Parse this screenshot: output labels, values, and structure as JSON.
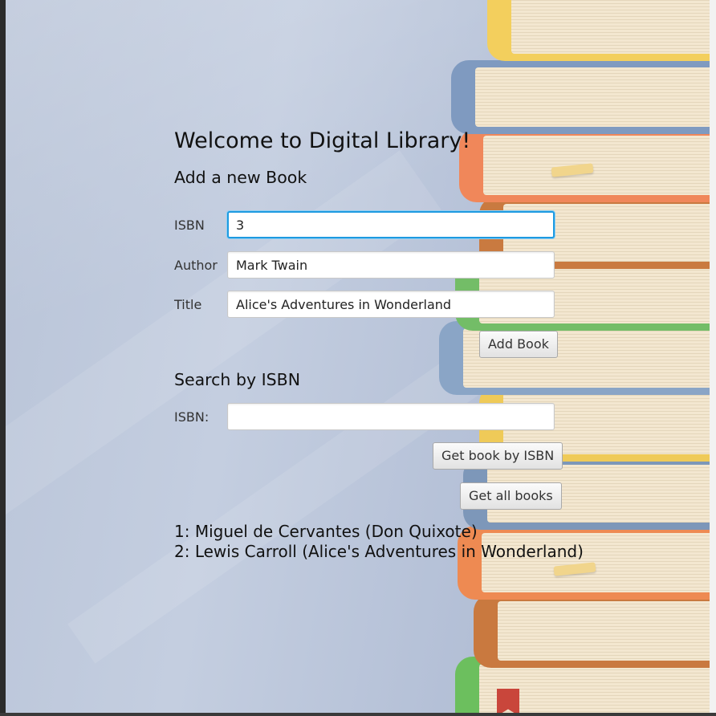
{
  "app": {
    "welcome_title": "Welcome to Digital Library!"
  },
  "add_book": {
    "heading": "Add a new Book",
    "isbn_label": "ISBN",
    "isbn_value": "3",
    "author_label": "Author",
    "author_value": "Mark Twain",
    "title_label": "Title",
    "title_value": "Alice's Adventures in Wonderland",
    "add_button": "Add Book"
  },
  "search": {
    "heading": "Search by ISBN",
    "isbn_label": "ISBN:",
    "isbn_value": "",
    "get_by_isbn_button": "Get book by ISBN",
    "get_all_button": "Get all books"
  },
  "results": [
    "1: Miguel de Cervantes (Don Quixote)",
    "2: Lewis Carroll (Alice's Adventures in Wonderland)"
  ],
  "colors": {
    "focus_accent": "#1e9ae0",
    "background": "#b7c3d8"
  }
}
